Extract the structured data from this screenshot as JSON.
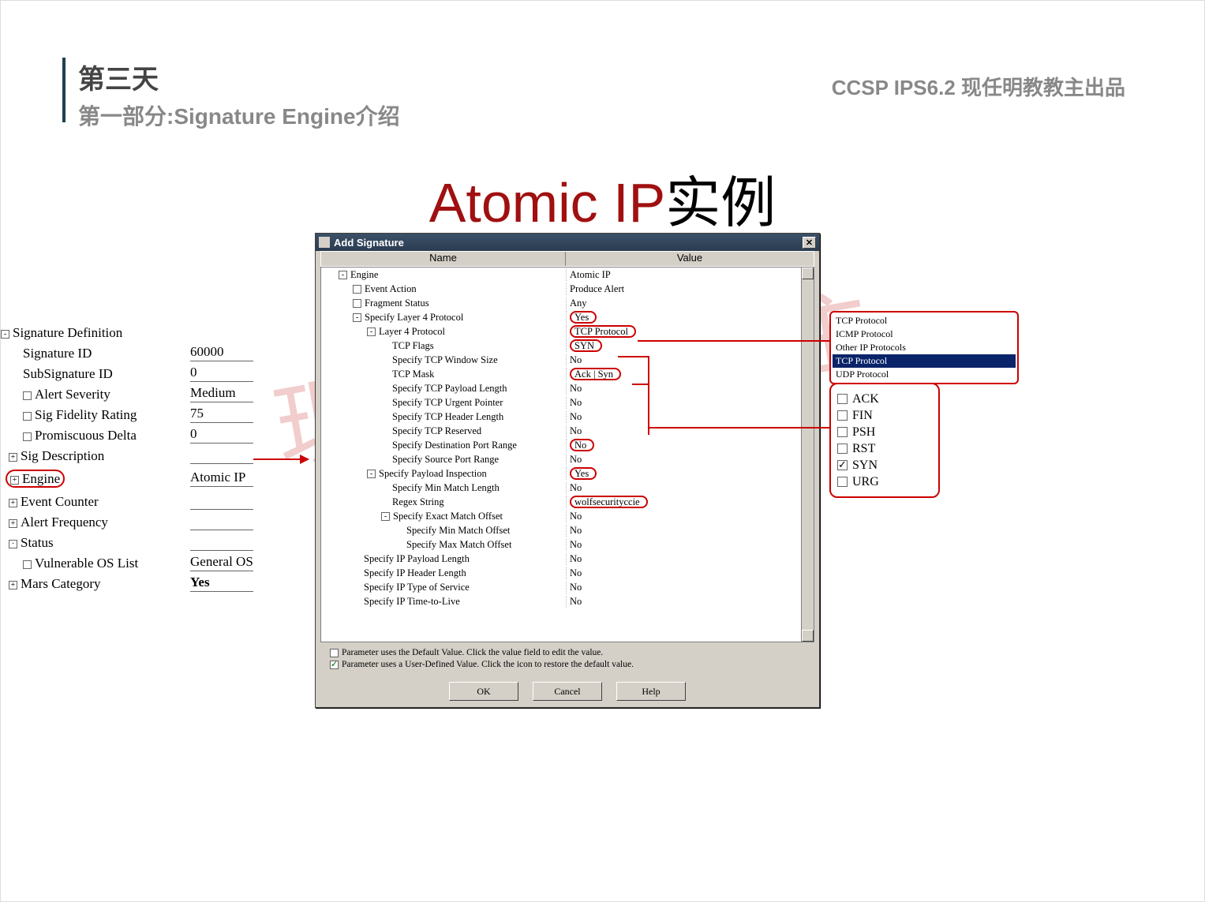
{
  "header": {
    "title": "第三天",
    "subtitle": "第一部分:Signature Engine介绍",
    "right": "CCSP IPS6.2  现任明教教主出品"
  },
  "main_title": {
    "red": "Atomic IP",
    "black": "实例"
  },
  "watermark": "现任明教教主",
  "sig_def": {
    "root": "Signature Definition",
    "rows": [
      {
        "label": "Signature ID",
        "value": "60000",
        "indent": 1
      },
      {
        "label": "SubSignature ID",
        "value": "0",
        "indent": 1
      },
      {
        "label": "Alert Severity",
        "value": "Medium",
        "indent": 1,
        "chk": true
      },
      {
        "label": "Sig Fidelity Rating",
        "value": "75",
        "indent": 1,
        "chk": true
      },
      {
        "label": "Promiscuous Delta",
        "value": "0",
        "indent": 1,
        "chk": true
      }
    ],
    "sig_desc": "Sig Description",
    "engine_label": "Engine",
    "engine_value": "Atomic IP",
    "event_counter": "Event Counter",
    "alert_freq": "Alert Frequency",
    "status": "Status",
    "vuln_os_label": "Vulnerable OS List",
    "vuln_os_value": "General OS",
    "mars_label": "Mars Category",
    "mars_value": "Yes"
  },
  "dialog": {
    "title": "Add Signature",
    "col_name": "Name",
    "col_value": "Value",
    "rows": [
      {
        "name": "Engine",
        "value": "Atomic IP",
        "indent": 1,
        "toggle": "-"
      },
      {
        "name": "Event Action",
        "value": "Produce Alert",
        "indent": 2,
        "chk": true
      },
      {
        "name": "Fragment Status",
        "value": "Any",
        "indent": 2,
        "chk": true
      },
      {
        "name": "Specify Layer 4 Protocol",
        "value": "Yes",
        "indent": 2,
        "toggle": "-",
        "circled": true
      },
      {
        "name": "Layer 4 Protocol",
        "value": "TCP Protocol",
        "indent": 3,
        "toggle": "-",
        "circled": true
      },
      {
        "name": "TCP Flags",
        "value": "SYN",
        "indent": 4,
        "circled": true
      },
      {
        "name": "Specify TCP Window Size",
        "value": "No",
        "indent": 4
      },
      {
        "name": "TCP Mask",
        "value": "Ack | Syn",
        "indent": 4,
        "circled": true
      },
      {
        "name": "Specify TCP Payload Length",
        "value": "No",
        "indent": 4
      },
      {
        "name": "Specify TCP Urgent Pointer",
        "value": "No",
        "indent": 4
      },
      {
        "name": "Specify TCP Header Length",
        "value": "No",
        "indent": 4
      },
      {
        "name": "Specify TCP Reserved",
        "value": "No",
        "indent": 4
      },
      {
        "name": "Specify Destination Port Range",
        "value": "No",
        "indent": 4,
        "circled": true
      },
      {
        "name": "Specify Source Port Range",
        "value": "No",
        "indent": 4
      },
      {
        "name": "Specify Payload Inspection",
        "value": "Yes",
        "indent": 3,
        "toggle": "-",
        "circled": true
      },
      {
        "name": "Specify Min Match Length",
        "value": "No",
        "indent": 4
      },
      {
        "name": "Regex String",
        "value": "wolfsecurityccie",
        "indent": 4,
        "circled": true
      },
      {
        "name": "Specify Exact Match Offset",
        "value": "No",
        "indent": 4,
        "toggle": "-"
      },
      {
        "name": "Specify Min Match Offset",
        "value": "No",
        "indent": 5
      },
      {
        "name": "Specify Max Match Offset",
        "value": "No",
        "indent": 5
      },
      {
        "name": "Specify IP Payload Length",
        "value": "No",
        "indent": 2
      },
      {
        "name": "Specify IP Header Length",
        "value": "No",
        "indent": 2
      },
      {
        "name": "Specify IP Type of Service",
        "value": "No",
        "indent": 2
      },
      {
        "name": "Specify IP Time-to-Live",
        "value": "No",
        "indent": 2
      }
    ],
    "note1": "Parameter uses the Default Value.  Click the value field to edit the value.",
    "note2": "Parameter uses a User-Defined Value.  Click the icon to restore the default value.",
    "buttons": {
      "ok": "OK",
      "cancel": "Cancel",
      "help": "Help"
    }
  },
  "dropdown": {
    "items": [
      {
        "label": "TCP Protocol",
        "selected": false
      },
      {
        "label": "ICMP Protocol",
        "selected": false
      },
      {
        "label": "Other IP Protocols",
        "selected": false
      },
      {
        "label": "TCP Protocol",
        "selected": true
      },
      {
        "label": "UDP Protocol",
        "selected": false
      }
    ]
  },
  "flags": [
    {
      "label": "ACK",
      "checked": false
    },
    {
      "label": "FIN",
      "checked": false
    },
    {
      "label": "PSH",
      "checked": false
    },
    {
      "label": "RST",
      "checked": false
    },
    {
      "label": "SYN",
      "checked": true
    },
    {
      "label": "URG",
      "checked": false
    }
  ]
}
